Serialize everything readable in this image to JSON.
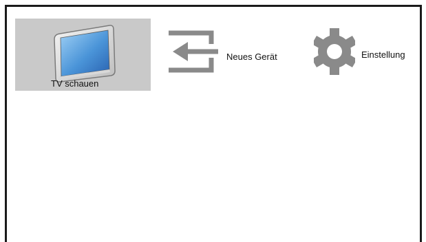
{
  "menu": {
    "items": [
      {
        "label": "TV schauen",
        "icon": "tv-icon",
        "selected": true
      },
      {
        "label": "Neues Gerät",
        "icon": "input-device-icon",
        "selected": false
      },
      {
        "label": "Einstellung",
        "icon": "gear-icon",
        "selected": false
      }
    ]
  },
  "colors": {
    "selection_background": "#c9c9c9",
    "icon_gray": "#8a8a8a",
    "screen_blue": "#3a7fc8",
    "frame": "#1a1a1a"
  }
}
